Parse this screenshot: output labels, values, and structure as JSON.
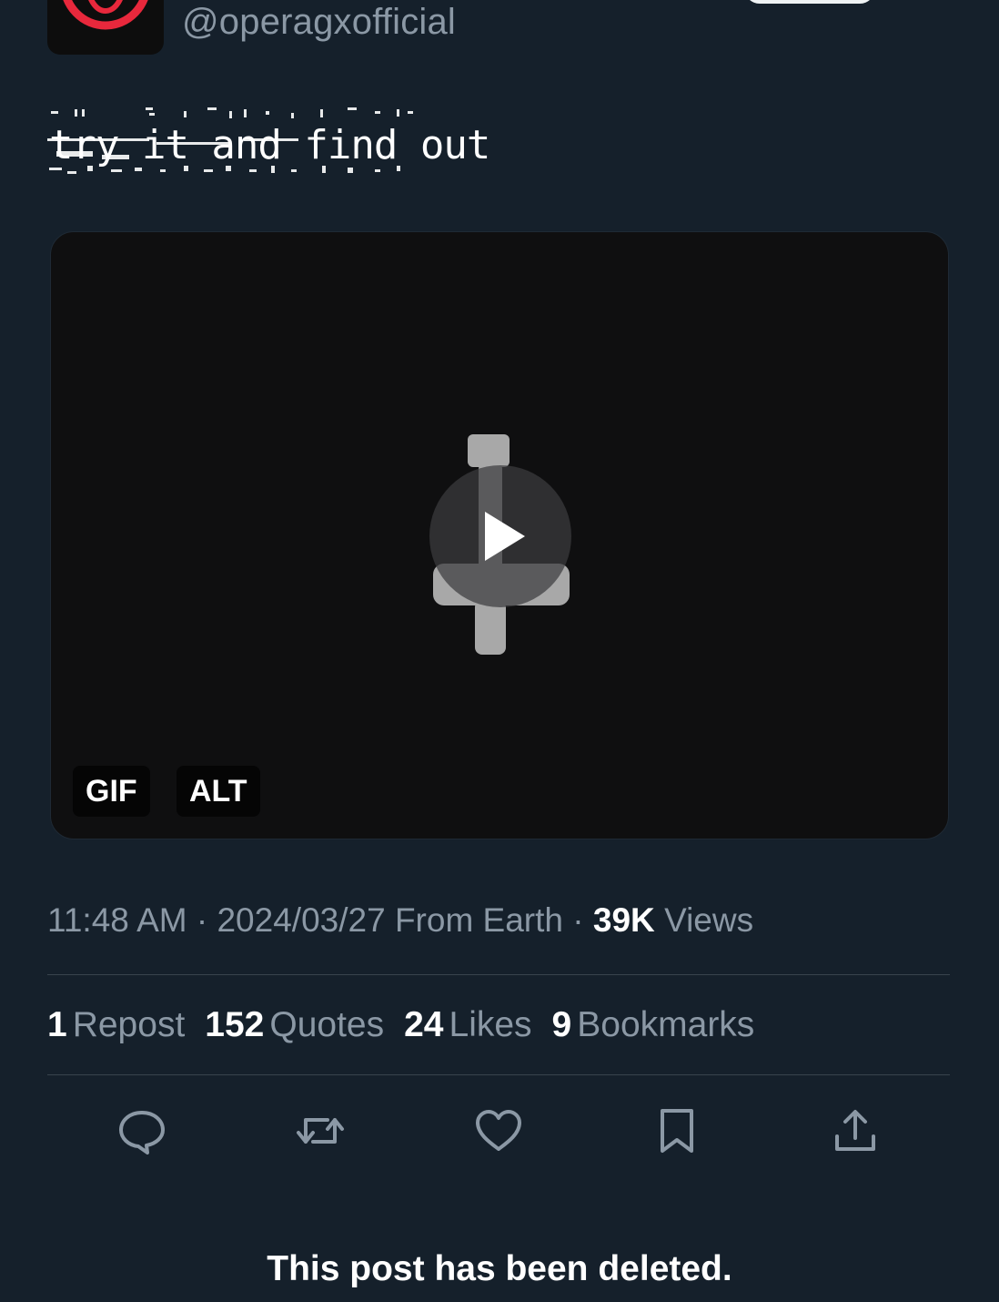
{
  "author": {
    "handle": "@operagxofficial"
  },
  "tweet": {
    "text": "try it and find out"
  },
  "media": {
    "badges": {
      "gif": "GIF",
      "alt": "ALT"
    }
  },
  "meta": {
    "time": "11:48 AM",
    "date": "2024/03/27",
    "source": "From Earth",
    "views_count": "39K",
    "views_label": "Views",
    "separator": "·"
  },
  "stats": [
    {
      "count": "1",
      "label": "Repost"
    },
    {
      "count": "152",
      "label": "Quotes"
    },
    {
      "count": "24",
      "label": "Likes"
    },
    {
      "count": "9",
      "label": "Bookmarks"
    }
  ],
  "actions": {
    "reply_icon": "speech-bubble-icon",
    "repost_icon": "repost-arrows-icon",
    "like_icon": "heart-icon",
    "bookmark_icon": "bookmark-icon",
    "share_icon": "share-upload-icon"
  },
  "notice": "This post has been deleted.",
  "colors": {
    "background": "#15202b",
    "muted_text": "#8b98a5",
    "brand_red": "#e8283c"
  }
}
